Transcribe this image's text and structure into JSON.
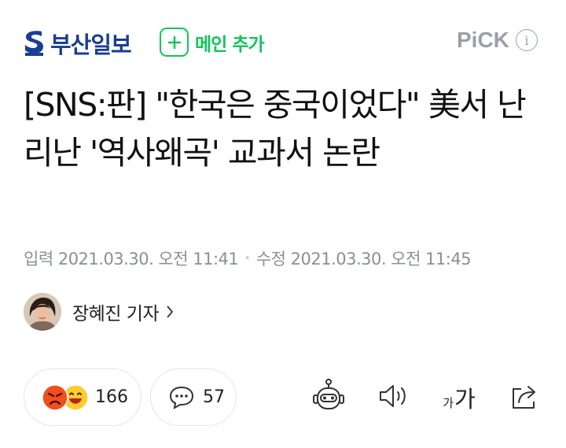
{
  "header": {
    "brand_name": "부산일보",
    "add_main_label": "메인 추가",
    "pick_label": "PiCK",
    "info_symbol": "i"
  },
  "article": {
    "headline": "[SNS:판] \"한국은 중국이었다\" 美서 난리난 '역사왜곡' 교과서 논란",
    "input_label": "입력",
    "input_time": "2021.03.30. 오전 11:41",
    "separator": "•",
    "edit_label": "수정",
    "edit_time": "2021.03.30. 오전 11:45"
  },
  "reporter": {
    "name": "장혜진 기자"
  },
  "actions": {
    "reaction_count": "166",
    "comment_count": "57",
    "font_small": "가",
    "font_big": "가"
  },
  "colors": {
    "brand_blue": "#1a3e91",
    "accent_green": "#0fc65a",
    "meta_gray": "#8b8f94",
    "pick_gray": "#9aa0a6"
  },
  "icons": [
    "brand-logo-icon",
    "plus-icon",
    "info-icon",
    "chevron-right-icon",
    "angry-emoji-icon",
    "smile-emoji-icon",
    "comment-icon",
    "robot-summary-icon",
    "speaker-icon",
    "font-size-icon",
    "share-icon"
  ]
}
